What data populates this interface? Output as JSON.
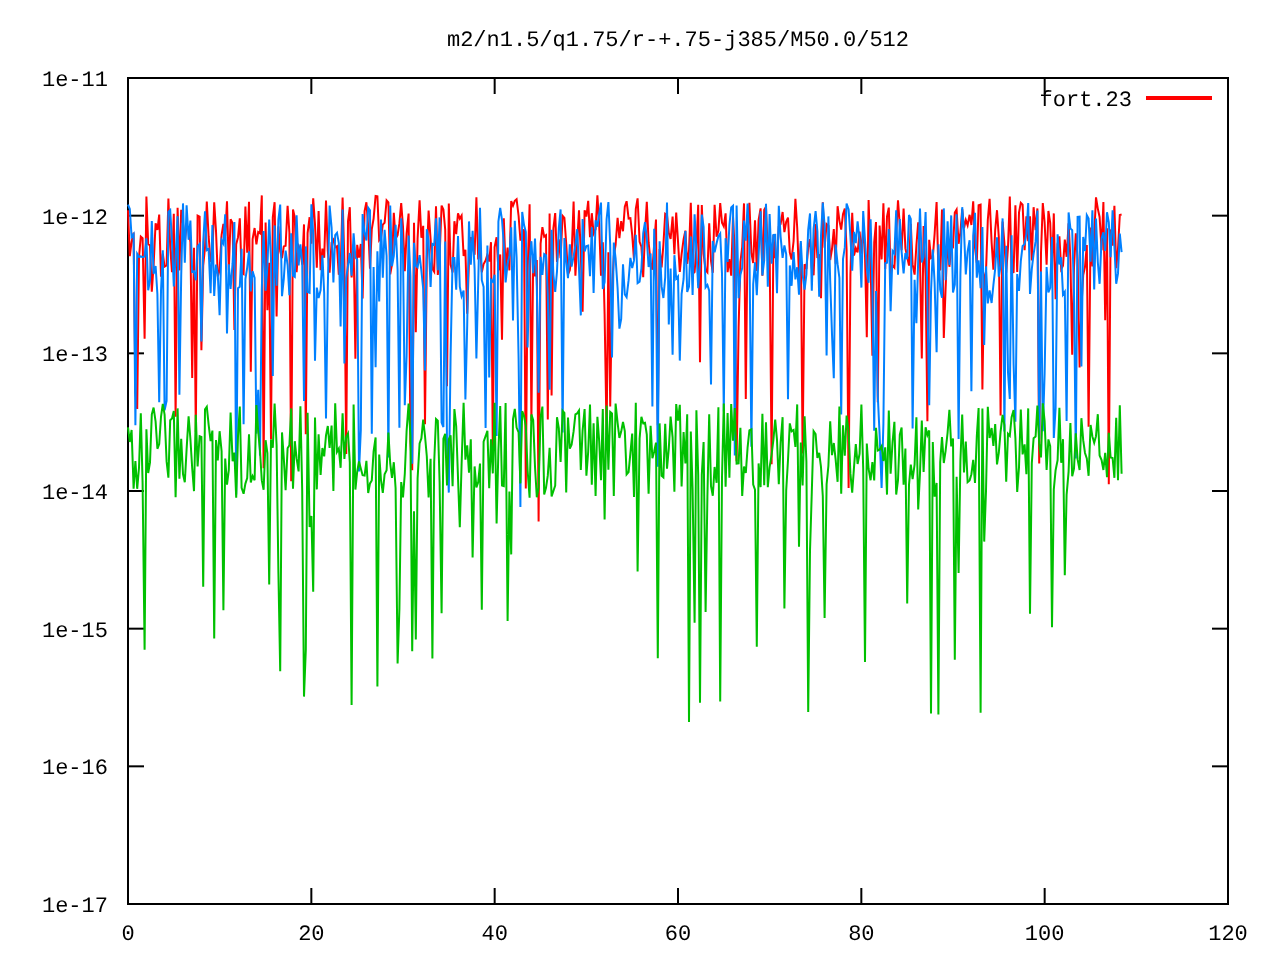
{
  "plot": {
    "title": "m2/n1.5/q1.75/r-+.75-j385/M50.0/512",
    "y_axis_labels": [
      "1e-11",
      "1e-12",
      "1e-13",
      "1e-14",
      "1e-15",
      "1e-16",
      "1e-17"
    ],
    "x_axis_labels": [
      "0",
      "20",
      "40",
      "60",
      "80",
      "100",
      "120"
    ],
    "legend": [
      {
        "label": "fort.23",
        "color": "#ff0000"
      }
    ]
  }
}
